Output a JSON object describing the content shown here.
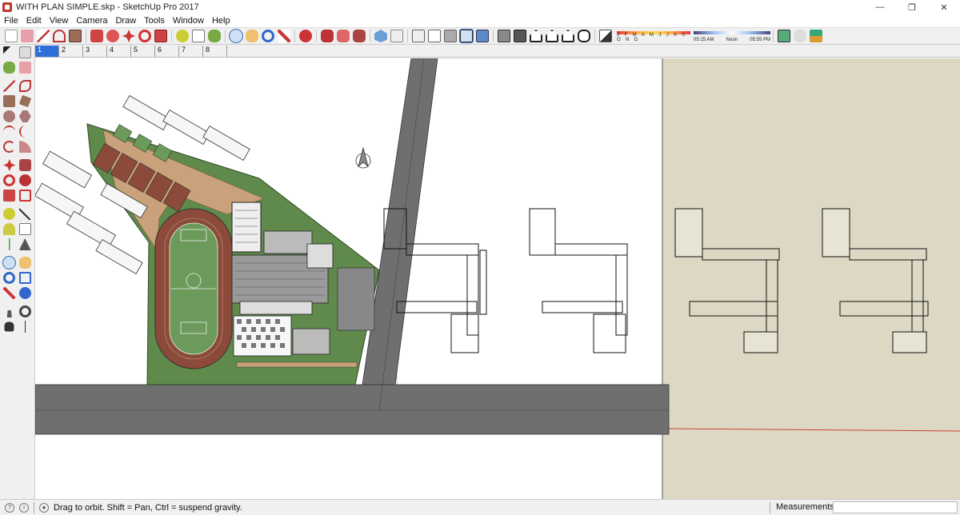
{
  "window": {
    "title": "WITH PLAN SIMPLE.skp - SketchUp Pro 2017",
    "minimize": "—",
    "maximize": "❐",
    "close": "✕"
  },
  "menu": [
    "File",
    "Edit",
    "View",
    "Camera",
    "Draw",
    "Tools",
    "Window",
    "Help"
  ],
  "shadows": {
    "months_label": "J F M A M J J A S O N D",
    "time_start": "05:15 AM",
    "time_noon": "Noon",
    "time_end": "05:55 PM"
  },
  "scene_tabs": [
    "1",
    "2",
    "3",
    "4",
    "5",
    "6",
    "7",
    "8"
  ],
  "active_scene": "1",
  "status": {
    "message": "Drag to orbit. Shift = Pan, Ctrl = suspend gravity.",
    "measurements_label": "Measurements",
    "measurements_value": ""
  },
  "colors": {
    "ground_beige": "#dcd8c4",
    "road": "#6f6f6f",
    "grass": "#5f8a4c",
    "track": "#8b4a3a",
    "sand": "#c9a17a",
    "accent_blue": "#2e6fd8"
  }
}
